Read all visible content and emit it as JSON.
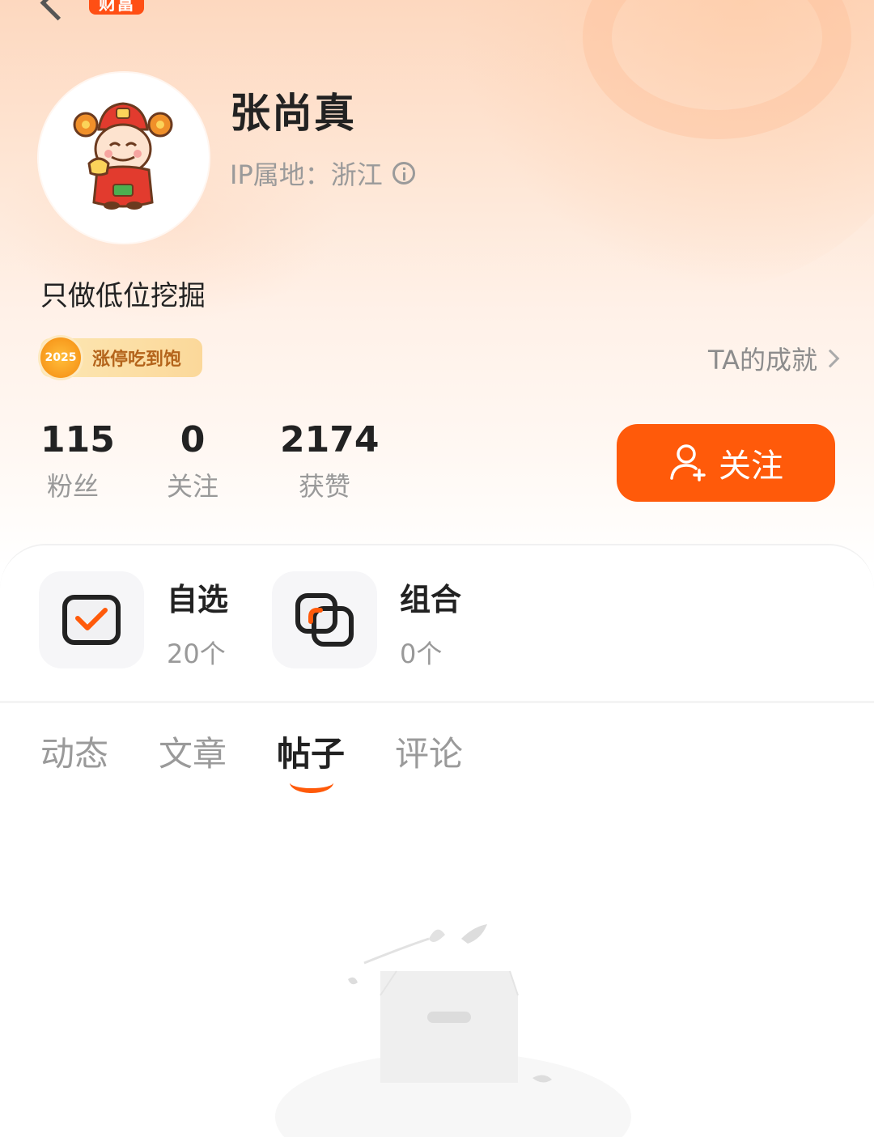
{
  "header": {
    "badge": "财富"
  },
  "profile": {
    "name": "张尚真",
    "ip_location": "IP属地：浙江",
    "bio": "只做低位挖掘",
    "honor": {
      "year": "2025",
      "title": "涨停吃到饱"
    },
    "achievement_link": "TA的成就"
  },
  "stats": [
    {
      "value": "115",
      "label": "粉丝"
    },
    {
      "value": "0",
      "label": "关注"
    },
    {
      "value": "2174",
      "label": "获赞"
    }
  ],
  "follow_button": {
    "label": "关注"
  },
  "tools": [
    {
      "title": "自选",
      "count": "20个",
      "icon": "watchlist-check-icon"
    },
    {
      "title": "组合",
      "count": "0个",
      "icon": "portfolio-icon"
    }
  ],
  "tabs": [
    {
      "label": "动态",
      "active": false
    },
    {
      "label": "文章",
      "active": false
    },
    {
      "label": "帖子",
      "active": true
    },
    {
      "label": "评论",
      "active": false
    }
  ],
  "colors": {
    "accent": "#ff5a0a",
    "header_gradient_top": "#fdd8bf",
    "text_primary": "#222222",
    "text_secondary": "#999999"
  }
}
